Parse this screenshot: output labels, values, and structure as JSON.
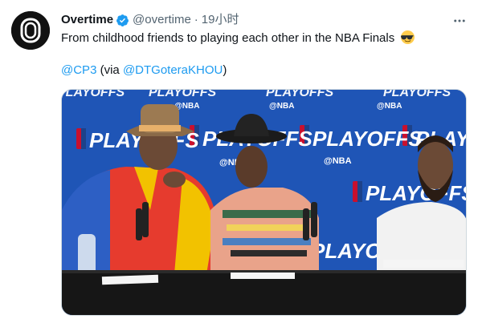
{
  "tweet": {
    "author_name": "Overtime",
    "author_handle": "@overtime",
    "separator": "·",
    "timestamp": "19小时",
    "body_text": "From childhood friends to playing each other in the NBA Finals",
    "emoji_icon": "sunglasses-face-emoji",
    "mention_1": "@CP3",
    "via_open": " (via ",
    "mention_2": "@DTGoteraKHOU",
    "via_close": ")"
  },
  "media": {
    "backdrop_texts": {
      "playoffs": "PLAYOFFS",
      "nba_tag": "@NBA"
    }
  },
  "colors": {
    "link": "#1d9bf0",
    "secondary_text": "#536471",
    "verified_badge": "#1d9bf0",
    "backdrop_blue": "#1f55b6"
  }
}
